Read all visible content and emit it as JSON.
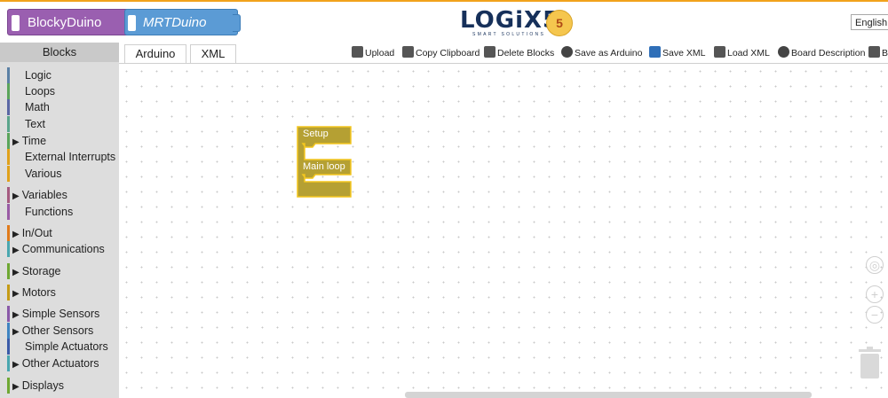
{
  "header": {
    "app_name": "BlockyDuino",
    "project_name": "MRTDuino",
    "logo_text": "LOGiX5",
    "logo_subtext": "SMART SOLUTIONS",
    "logo_badge": "5",
    "language": "English"
  },
  "sidebar": {
    "title": "Blocks",
    "categories": [
      {
        "label": "Logic",
        "arrow": false,
        "color": "#5b80a5"
      },
      {
        "label": "Loops",
        "arrow": false,
        "color": "#5ba55b"
      },
      {
        "label": "Math",
        "arrow": false,
        "color": "#5b67a5"
      },
      {
        "label": "Text",
        "arrow": false,
        "color": "#5ba58c"
      },
      {
        "label": "Time",
        "arrow": true,
        "color": "#5ba55b"
      },
      {
        "label": "External Interrupts",
        "arrow": false,
        "color": "#e0a11b"
      },
      {
        "label": "Various",
        "arrow": false,
        "color": "#e0a11b"
      },
      {
        "label": "Variables",
        "arrow": true,
        "color": "#a55b80"
      },
      {
        "label": "Functions",
        "arrow": false,
        "color": "#995ba5"
      },
      {
        "label": "In/Out",
        "arrow": true,
        "color": "#e07b1b"
      },
      {
        "label": "Communications",
        "arrow": true,
        "color": "#4aa7b0"
      },
      {
        "label": "Storage",
        "arrow": true,
        "color": "#6fa833"
      },
      {
        "label": "Motors",
        "arrow": true,
        "color": "#c59b16"
      },
      {
        "label": "Simple Sensors",
        "arrow": true,
        "color": "#8a5aa8"
      },
      {
        "label": "Other Sensors",
        "arrow": true,
        "color": "#3f84c2"
      },
      {
        "label": "Simple Actuators",
        "arrow": false,
        "color": "#3b5ba8"
      },
      {
        "label": "Other Actuators",
        "arrow": true,
        "color": "#4aa7b0"
      },
      {
        "label": "Displays",
        "arrow": true,
        "color": "#6fa833"
      }
    ]
  },
  "tabs": [
    {
      "label": "Arduino"
    },
    {
      "label": "XML"
    }
  ],
  "toolbar": {
    "upload": "Upload",
    "copy_clipboard": "Copy Clipboard",
    "delete_blocks": "Delete Blocks",
    "save_as_arduino": "Save as Arduino",
    "save_xml": "Save XML",
    "load_xml": "Load XML",
    "board_description": "Board Description",
    "cart_partial": "B"
  },
  "workspace": {
    "block_setup_label": "Setup",
    "block_loop_label": "Main loop",
    "block_color": "#b5a033",
    "zoom_in": "+",
    "zoom_out": "−"
  }
}
